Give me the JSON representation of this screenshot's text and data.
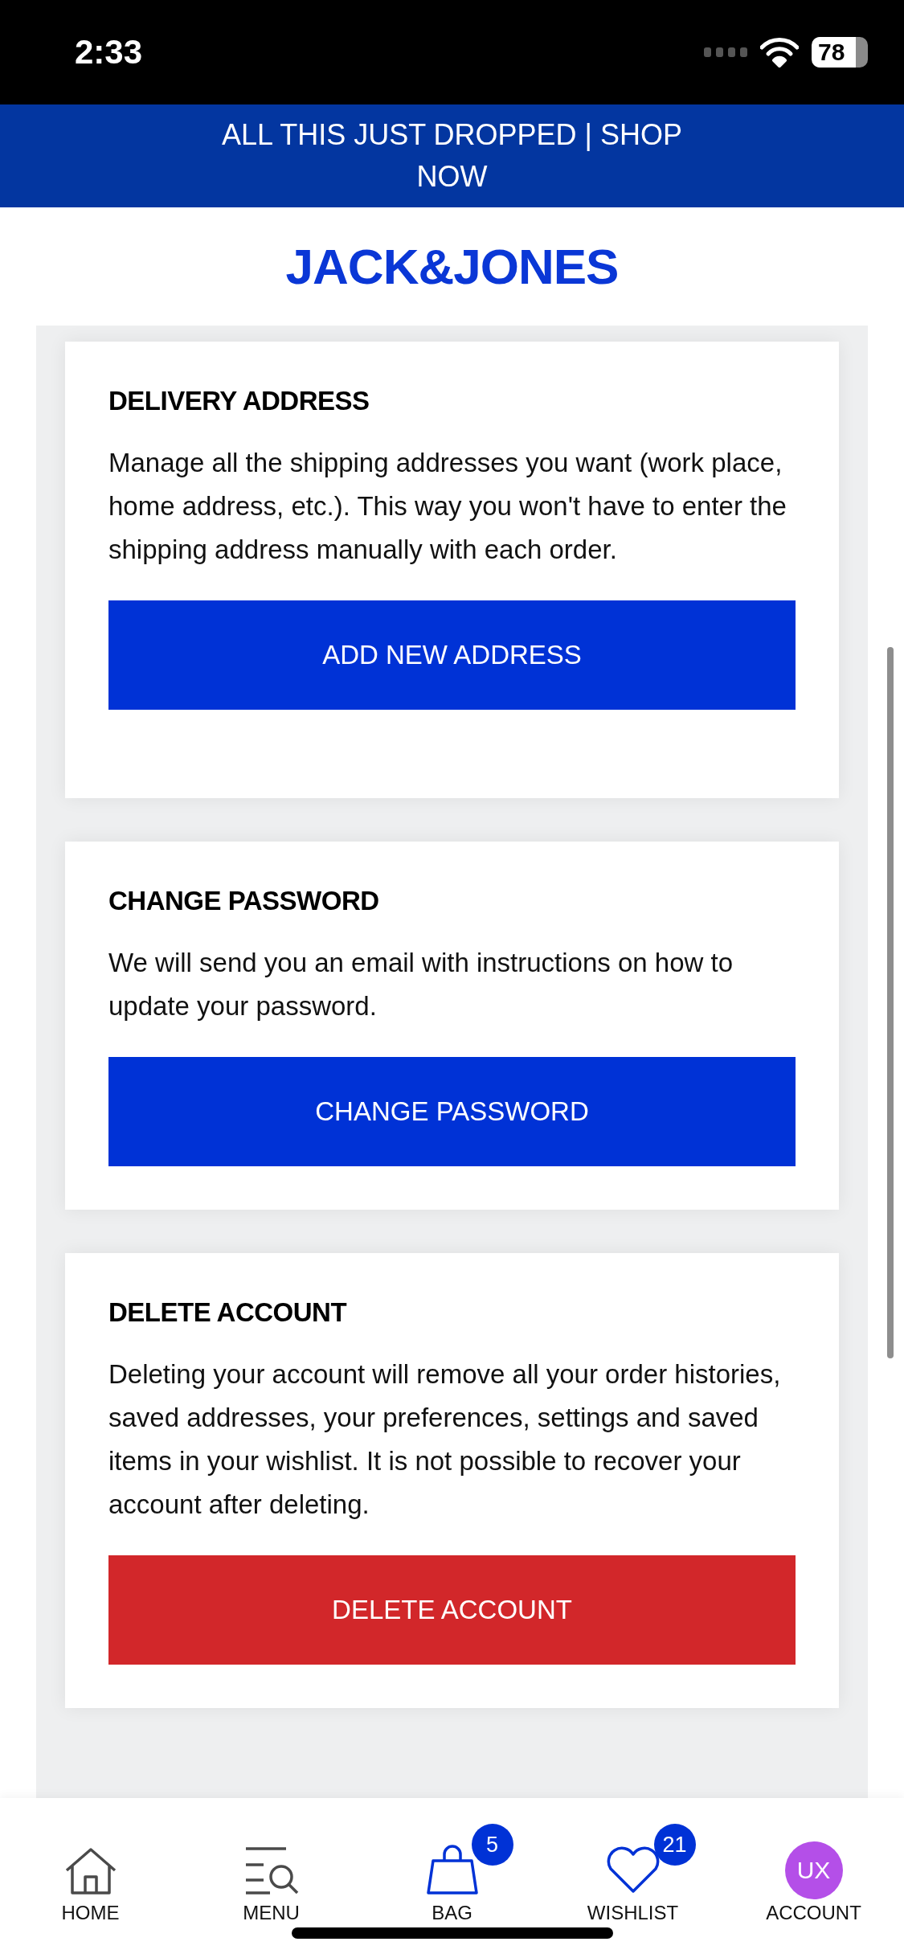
{
  "status_bar": {
    "time": "2:33",
    "battery": "78"
  },
  "promo_banner": {
    "text": "ALL THIS JUST DROPPED | SHOP NOW"
  },
  "header": {
    "logo": "JACK&JONES"
  },
  "sections": [
    {
      "title": "DELIVERY ADDRESS",
      "description": "Manage all the shipping addresses you want (work place, home address, etc.). This way you won't have to enter the shipping address manually with each order.",
      "button": {
        "label": "ADD NEW ADDRESS",
        "kind": "primary"
      }
    },
    {
      "title": "CHANGE PASSWORD",
      "description": "We will send you an email with instructions on how to update your password.",
      "button": {
        "label": "CHANGE PASSWORD",
        "kind": "primary"
      }
    },
    {
      "title": "DELETE ACCOUNT",
      "description": "Deleting your account will remove all your order histories, saved addresses, your preferences, settings and saved items in your wishlist. It is not possible to recover your account after deleting.",
      "button": {
        "label": "DELETE ACCOUNT",
        "kind": "danger"
      }
    }
  ],
  "bottom_nav": [
    {
      "kind": "home",
      "label": "HOME"
    },
    {
      "kind": "menu",
      "label": "MENU"
    },
    {
      "kind": "bag",
      "label": "BAG",
      "badge": "5"
    },
    {
      "kind": "wishlist",
      "label": "WISHLIST",
      "badge": "21"
    },
    {
      "kind": "account",
      "label": "ACCOUNT",
      "avatar": "UX"
    }
  ]
}
